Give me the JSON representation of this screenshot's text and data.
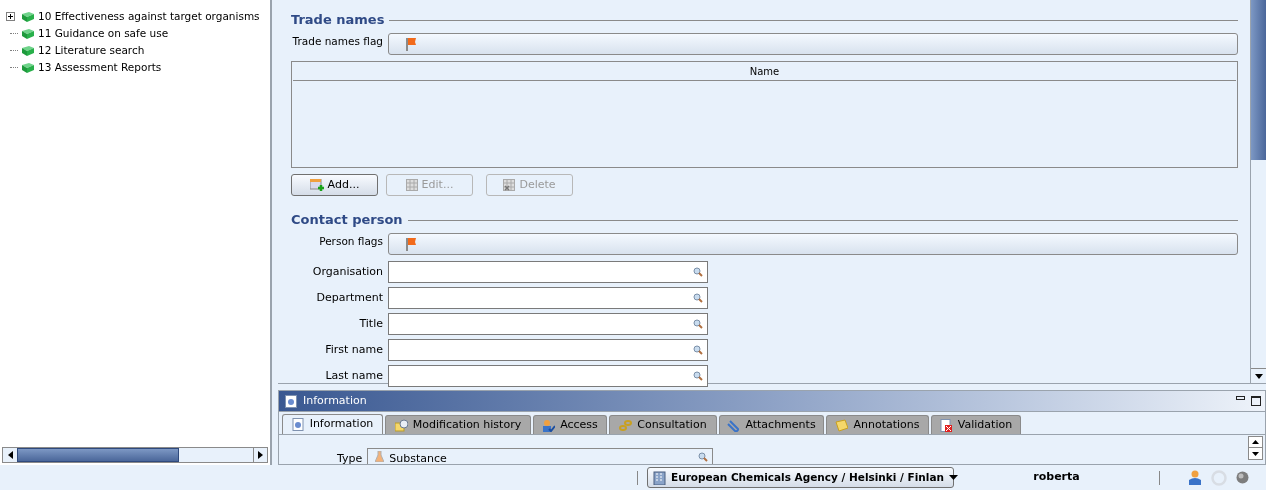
{
  "tree": {
    "items": [
      {
        "label": "10 Effectiveness against target organisms",
        "kind": "folder",
        "expanded": false
      },
      {
        "label": "11 Guidance on safe use",
        "kind": "leaf"
      },
      {
        "label": "12 Literature search",
        "kind": "leaf"
      },
      {
        "label": "13 Assessment Reports",
        "kind": "leaf"
      }
    ]
  },
  "trade_names": {
    "heading": "Trade names",
    "flag_label": "Trade names flag",
    "table": {
      "columns": [
        "Name"
      ]
    },
    "buttons": [
      {
        "label": "Add...",
        "disabled": false
      },
      {
        "label": "Edit...",
        "disabled": true
      },
      {
        "label": "Delete",
        "disabled": true
      }
    ]
  },
  "contact_person": {
    "heading": "Contact person",
    "flag_label": "Person flags",
    "fields": [
      {
        "label": "Organisation"
      },
      {
        "label": "Department"
      },
      {
        "label": "Title"
      },
      {
        "label": "First name"
      },
      {
        "label": "Last name"
      }
    ]
  },
  "info_panel": {
    "title": "Information",
    "tabs": [
      {
        "label": "Information",
        "selected": true
      },
      {
        "label": "Modification history",
        "selected": false
      },
      {
        "label": "Access",
        "selected": false
      },
      {
        "label": "Consultation",
        "selected": false
      },
      {
        "label": "Attachments",
        "selected": false
      },
      {
        "label": "Annotations",
        "selected": false
      },
      {
        "label": "Validation",
        "selected": false
      }
    ],
    "type_label": "Type",
    "type_value": "Substance"
  },
  "status_bar": {
    "location": "European Chemicals Agency / Helsinki / Finlan",
    "user": "roberta"
  }
}
